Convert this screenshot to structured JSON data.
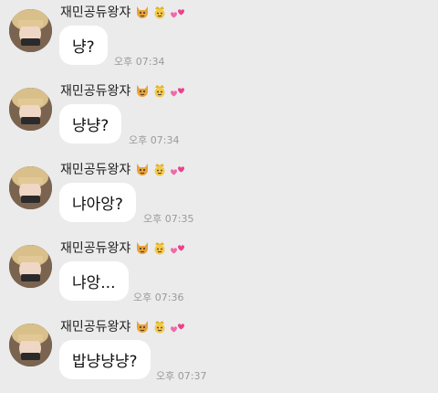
{
  "sender": {
    "name": "재민공듀왕쟈",
    "badges": [
      "cat-devil-icon",
      "crown-face-icon",
      "two-hearts-icon"
    ]
  },
  "messages": [
    {
      "text": "냥?",
      "time": "오후 07:34"
    },
    {
      "text": "냥냥?",
      "time": "오후 07:34"
    },
    {
      "text": "냐아앙?",
      "time": "오후 07:35"
    },
    {
      "text": "냐앙...",
      "time": "오후 07:36"
    },
    {
      "text": "밥냥냥냥?",
      "time": "오후 07:37"
    }
  ],
  "colors": {
    "background": "#ebebeb",
    "bubble": "#ffffff",
    "timestamp": "#9a9a9a"
  }
}
